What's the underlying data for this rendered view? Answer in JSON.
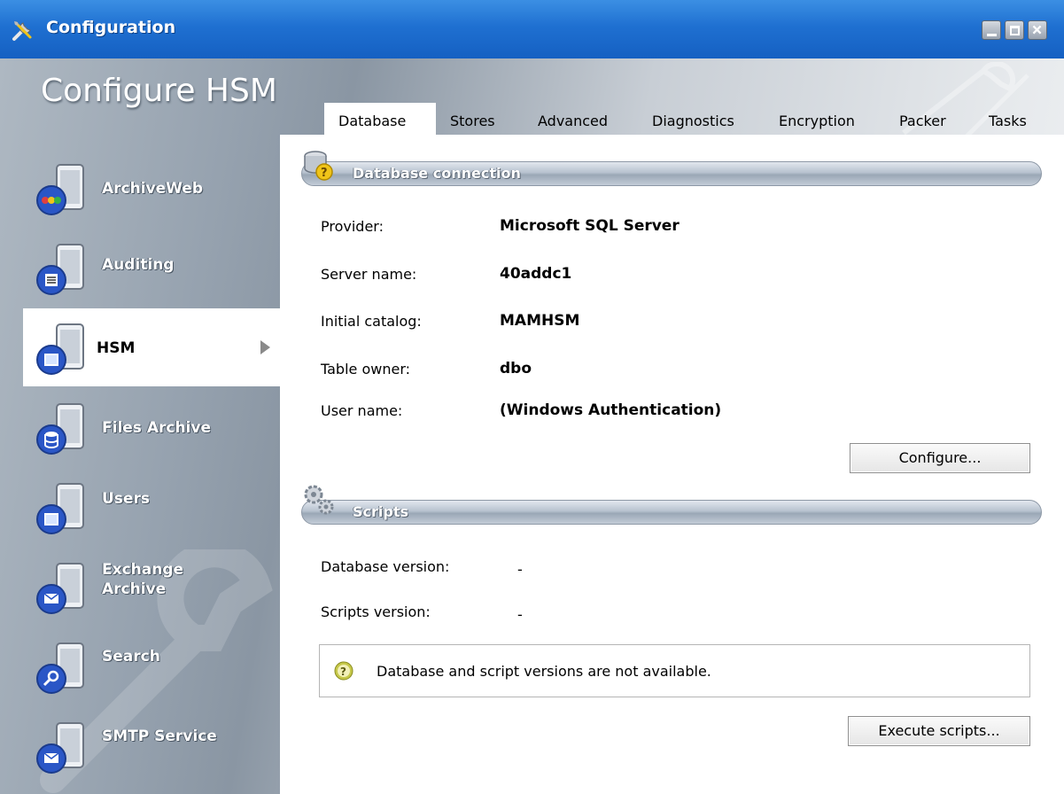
{
  "window": {
    "title": "Configuration",
    "icon": "tools-icon",
    "controls": [
      "minimize-icon",
      "maximize-icon",
      "close-icon"
    ]
  },
  "app_title": "Configure HSM",
  "sidebar": {
    "items": [
      {
        "label": "ArchiveWeb",
        "icon": "archiveweb-server-icon"
      },
      {
        "label": "Auditing",
        "icon": "auditing-server-icon"
      },
      {
        "label": "HSM",
        "icon": "hsm-server-icon",
        "selected": true
      },
      {
        "label": "Files Archive",
        "icon": "files-archive-server-icon"
      },
      {
        "label": "Users",
        "icon": "users-server-icon"
      },
      {
        "label": "Exchange",
        "label2": "Archive",
        "icon": "exchange-archive-server-icon"
      },
      {
        "label": "Search",
        "icon": "search-server-icon"
      },
      {
        "label": "SMTP Service",
        "icon": "smtp-service-server-icon"
      }
    ]
  },
  "tabs": [
    "Database",
    "Stores",
    "Advanced",
    "Diagnostics",
    "Encryption",
    "Packer",
    "Tasks"
  ],
  "active_tab": "Database",
  "db_section": {
    "title": "Database connection",
    "fields": [
      {
        "label": "Provider:",
        "value": "Microsoft SQL Server"
      },
      {
        "label": "Server name:",
        "value": "40addc1"
      },
      {
        "label": "Initial catalog:",
        "value": "MAMHSM"
      },
      {
        "label": "Table owner:",
        "value": "dbo"
      },
      {
        "label": "User name:",
        "value": "(Windows Authentication)"
      }
    ],
    "configure_button": "Configure..."
  },
  "scripts_section": {
    "title": "Scripts",
    "db_version_label": "Database version:",
    "db_version_value": "-",
    "scripts_version_label": "Scripts version:",
    "scripts_version_value": "-",
    "info_message": "Database and script versions are not available.",
    "execute_button": "Execute scripts..."
  },
  "colors": {
    "titlebar": "#1f70d1",
    "accent_yellow": "#f0c419",
    "panel_bg": "#ffffff"
  }
}
